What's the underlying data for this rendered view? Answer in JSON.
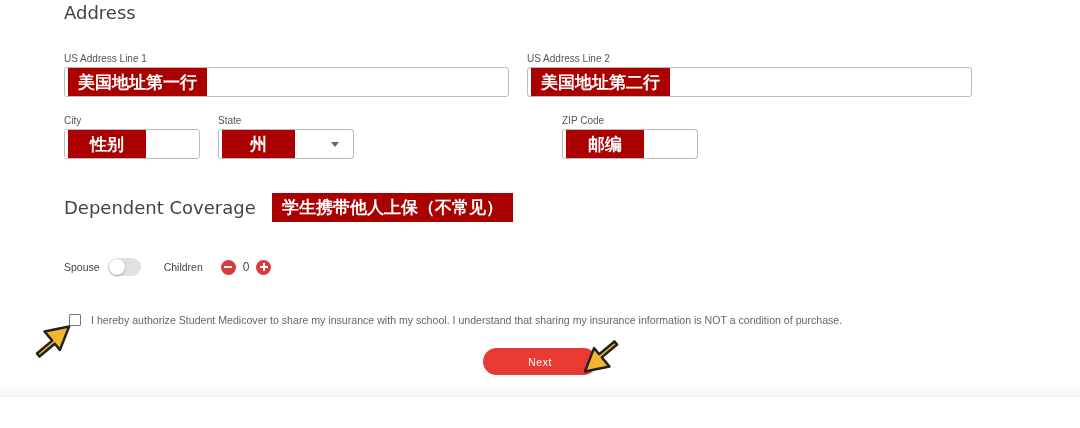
{
  "address": {
    "title": "Address",
    "rows": [
      {
        "fields": [
          {
            "label": "US Address Line 1",
            "annotation": "美国地址第一行",
            "kind": "text"
          },
          {
            "label": "US Address Line 2",
            "annotation": "美国地址第二行",
            "kind": "text"
          }
        ]
      },
      {
        "fields": [
          {
            "label": "City",
            "annotation": "性别",
            "kind": "text"
          },
          {
            "label": "State",
            "annotation": "州",
            "kind": "select"
          },
          {
            "label": "ZIP Code",
            "annotation": "邮编",
            "kind": "text"
          }
        ]
      }
    ]
  },
  "dependent_coverage": {
    "title": "Dependent Coverage",
    "annotation": "学生携带他人上保（不常见）",
    "spouse": {
      "label": "Spouse",
      "on": false
    },
    "children": {
      "label": "Children",
      "count": "0"
    }
  },
  "consent": {
    "text": "I hereby authorize Student Medicover to share my insurance with my school. I understand that sharing my insurance information is NOT a condition of purchase.",
    "checked": false
  },
  "next_button": "Next"
}
